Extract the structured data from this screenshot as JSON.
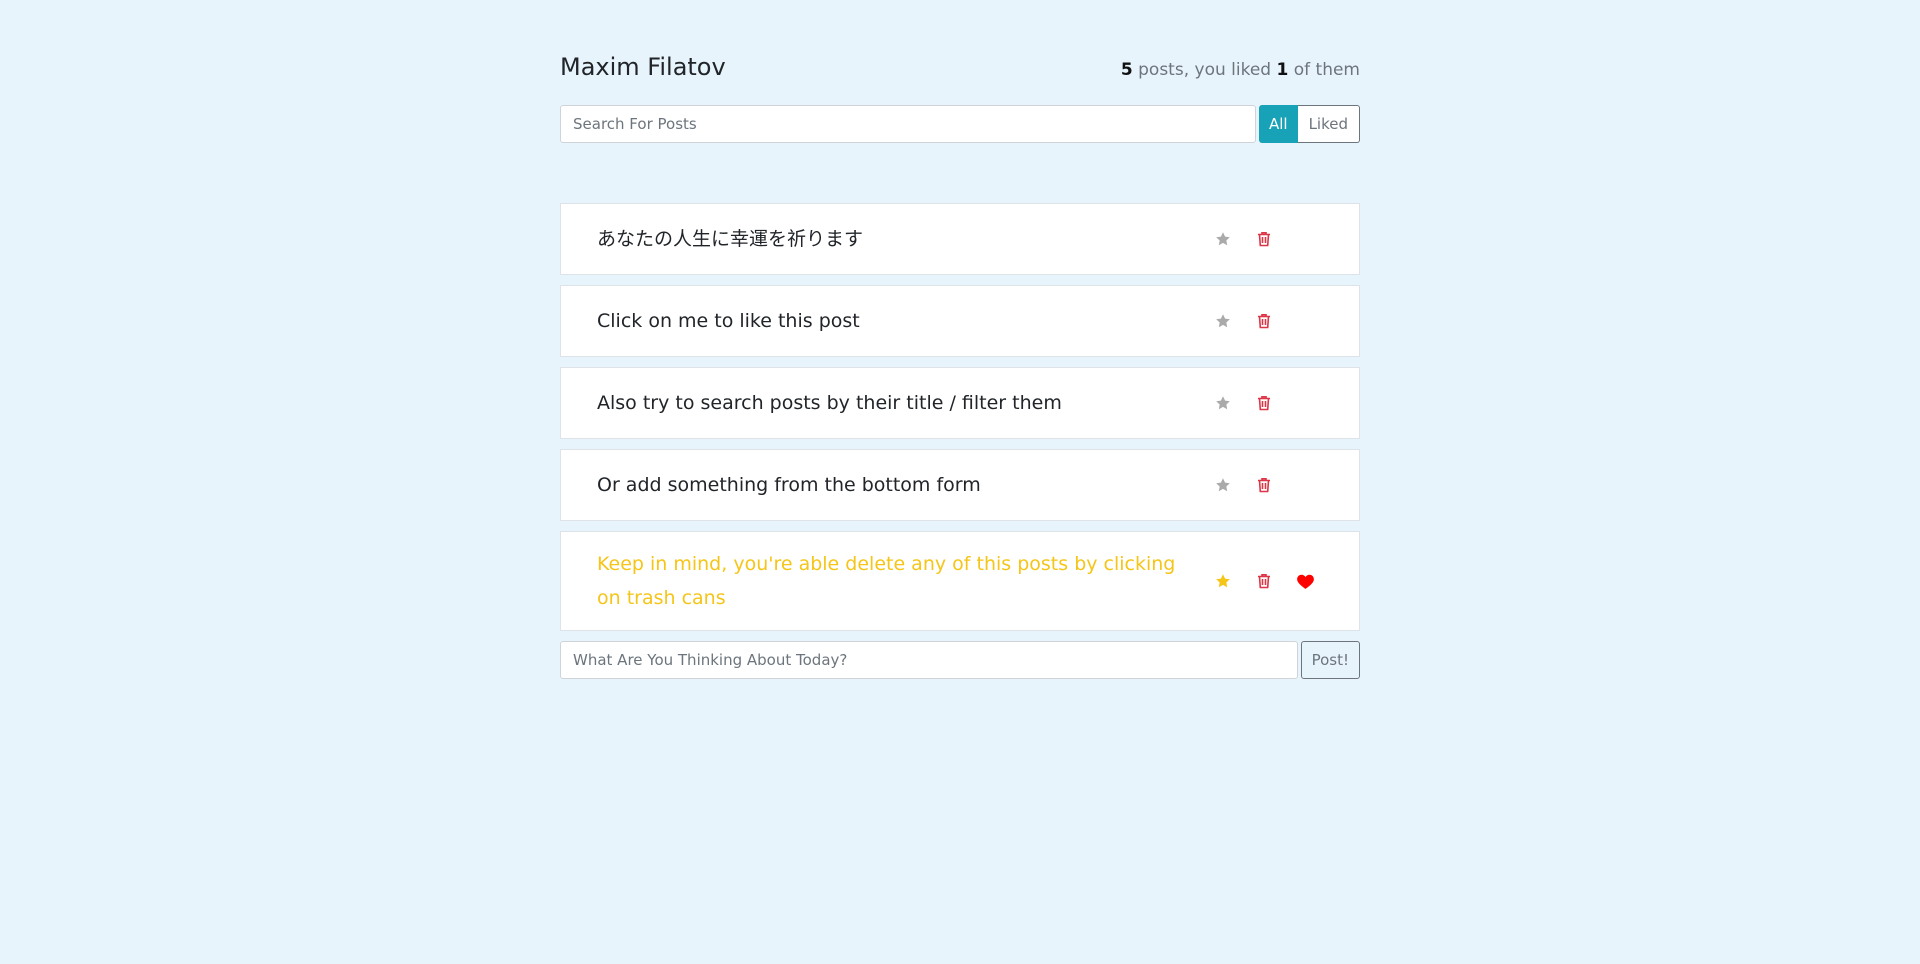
{
  "header": {
    "title": "Maxim Filatov",
    "stats": {
      "total": "5",
      "posts_text": " posts, you liked ",
      "liked": "1",
      "of_them_text": " of them"
    }
  },
  "search": {
    "placeholder": "Search For Posts",
    "value": ""
  },
  "filters": {
    "all_label": "All",
    "liked_label": "Liked",
    "active": "All"
  },
  "posts": [
    {
      "label": "あなたの人生に幸運を祈ります",
      "important": false,
      "liked": false
    },
    {
      "label": "Click on me to like this post",
      "important": false,
      "liked": false
    },
    {
      "label": "Also try to search posts by their title / filter them",
      "important": false,
      "liked": false
    },
    {
      "label": "Or add something from the bottom form",
      "important": false,
      "liked": false
    },
    {
      "label": "Keep in mind, you're able delete any of this posts by clicking on trash cans",
      "important": true,
      "liked": true
    }
  ],
  "add_form": {
    "placeholder": "What Are You Thinking About Today?",
    "value": "",
    "submit_label": "Post!"
  },
  "colors": {
    "background": "#e8f4fb",
    "accent": "#17a2b8",
    "star_default": "#aaaaaa",
    "star_important": "#f5c518",
    "trash": "#dc3545",
    "heart": "#ff0000"
  },
  "icons": {
    "important": "star-icon",
    "delete": "trash-icon",
    "liked": "heart-icon"
  }
}
